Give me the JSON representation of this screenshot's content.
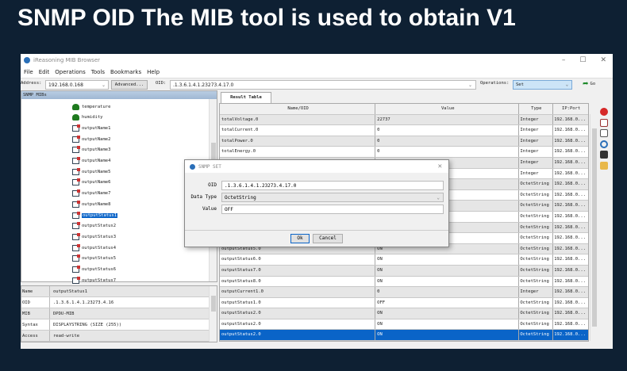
{
  "headline": "SNMP OID The MIB tool is used to obtain V1",
  "window": {
    "title": "iReasoning MIB Browser",
    "controls": [
      "–",
      "☐",
      "✕"
    ]
  },
  "menu": [
    "File",
    "Edit",
    "Operations",
    "Tools",
    "Bookmarks",
    "Help"
  ],
  "toolbar": {
    "address_label": "Address:",
    "address": "192.168.0.168",
    "advanced": "Advanced...",
    "oid_label": "OID:",
    "oid": ".1.3.6.1.4.1.23273.4.17.0",
    "operations_label": "Operations:",
    "operation": "Set",
    "go": "Go"
  },
  "left": {
    "header": "SNMP MIBs",
    "tree": [
      "temperature",
      "humidity",
      "outputName1",
      "outputName2",
      "outputName3",
      "outputName4",
      "outputName5",
      "outputName6",
      "outputName7",
      "outputName8",
      "outputStatus1",
      "outputStatus2",
      "outputStatus3",
      "outputStatus4",
      "outputStatus5",
      "outputStatus6",
      "outputStatus7"
    ],
    "selected_index": 10
  },
  "props": [
    {
      "k": "Name",
      "v": "outputStatus1"
    },
    {
      "k": "OID",
      "v": ".1.3.6.1.4.1.23273.4.16"
    },
    {
      "k": "MIB",
      "v": "DPDU-MIB"
    },
    {
      "k": "Syntax",
      "v": "DISPLAYSTRING (SIZE (255))"
    },
    {
      "k": "Access",
      "v": "read-write"
    }
  ],
  "result": {
    "tab": "Result Table",
    "columns": [
      "Name/OID",
      "Value",
      "Type",
      "IP:Port"
    ],
    "rows": [
      [
        "totalVoltage.0",
        "22737",
        "Integer",
        "192.168.0..."
      ],
      [
        "totalCurrent.0",
        "0",
        "Integer",
        "192.168.0..."
      ],
      [
        "totalPower.0",
        "0",
        "Integer",
        "192.168.0..."
      ],
      [
        "totalEnergy.0",
        "0",
        "Integer",
        "192.168.0..."
      ],
      [
        "",
        "",
        "Integer",
        "192.168.0..."
      ],
      [
        "",
        "",
        "Integer",
        "192.168.0..."
      ],
      [
        "",
        "",
        "OctetString",
        "192.168.0..."
      ],
      [
        "",
        "",
        "OctetString",
        "192.168.0..."
      ],
      [
        "",
        "",
        "OctetString",
        "192.168.0..."
      ],
      [
        "",
        "",
        "OctetString",
        "192.168.0..."
      ],
      [
        "",
        "",
        "OctetString",
        "192.168.0..."
      ],
      [
        "",
        "",
        "OctetString",
        "192.168.0..."
      ],
      [
        "outputStatus5.0",
        "ON",
        "OctetString",
        "192.168.0..."
      ],
      [
        "outputStatus6.0",
        "ON",
        "OctetString",
        "192.168.0..."
      ],
      [
        "outputStatus7.0",
        "ON",
        "OctetString",
        "192.168.0..."
      ],
      [
        "outputStatus8.0",
        "ON",
        "OctetString",
        "192.168.0..."
      ],
      [
        "outputCurrent1.0",
        "0",
        "Integer",
        "192.168.0..."
      ],
      [
        "outputStatus1.0",
        "OFF",
        "OctetString",
        "192.168.0..."
      ],
      [
        "outputStatus2.0",
        "ON",
        "OctetString",
        "192.168.0..."
      ],
      [
        "outputStatus2.0",
        "ON",
        "OctetString",
        "192.168.0..."
      ],
      [
        "outputStatus2.0",
        "ON",
        "OctetString",
        "192.168.0..."
      ]
    ],
    "selected_row": 20
  },
  "dialog": {
    "title": "SNMP SET",
    "oid_label": "OID",
    "oid": ".1.3.6.1.4.1.23273.4.17.0",
    "type_label": "Data Type",
    "type": "OctetString",
    "value_label": "Value",
    "value": "OFF",
    "ok": "Ok",
    "cancel": "Cancel"
  }
}
